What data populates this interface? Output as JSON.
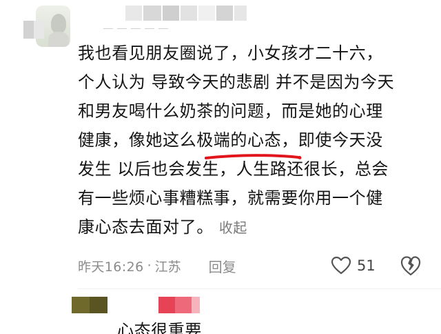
{
  "comment": {
    "lines": [
      "我也看见朋友圈说了，小女孩才二十六，",
      "个人认为 导致今天的悲剧 并不是因为今天",
      "和男友喝什么奶茶的问题，而是她的心理",
      "健康，像她这么极端的心态，即使今天没",
      "发生 以后也会发生，人生路还很长，总会",
      "有一些烦心事糟糕事，就需要你用一个健",
      "康心态去面对了。"
    ],
    "collapse_label": "收起",
    "underline_color": "#e0161c"
  },
  "meta": {
    "time": "昨天16:26",
    "separator": "·",
    "location": "江苏",
    "reply_label": "回复"
  },
  "actions": {
    "like_icon": "heart-outline-icon",
    "like_count": "51",
    "dislike_icon": "broken-heart-icon"
  },
  "reply": {
    "preview_text": "心态很重要"
  }
}
